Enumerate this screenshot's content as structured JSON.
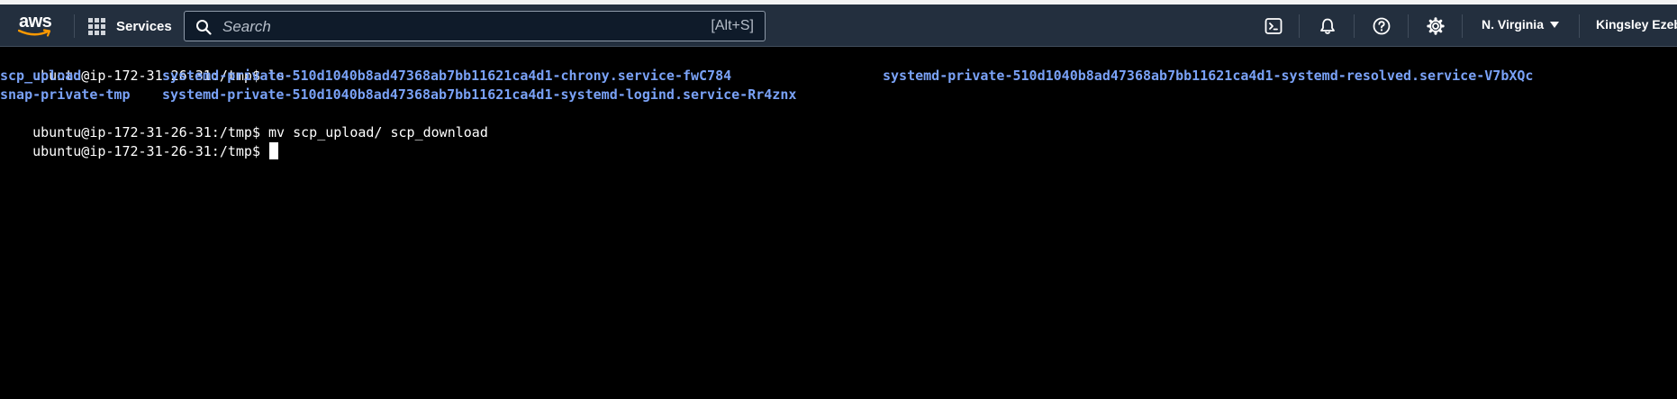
{
  "nav": {
    "logo_text": "aws",
    "services_label": "Services",
    "search_placeholder": "Search",
    "search_shortcut": "[Alt+S]",
    "icons": [
      "cloudshell-icon",
      "bell-icon",
      "help-icon",
      "settings-icon"
    ],
    "region_label": "N. Virginia",
    "user_label": "Kingsley Ezeb",
    "colors": {
      "navbar_bg": "#232f3e",
      "logo_smile": "#ff9900"
    }
  },
  "terminal": {
    "colors": {
      "background": "#000000",
      "text": "#ffffff",
      "directory": "#7aa2f7"
    },
    "commands": [
      {
        "prompt": "ubuntu@ip-172-31-26-31:/tmp$",
        "command": "ls"
      },
      {
        "prompt": "ubuntu@ip-172-31-26-31:/tmp$",
        "command": "mv scp_upload/ scp_download"
      },
      {
        "prompt": "ubuntu@ip-172-31-26-31:/tmp$",
        "command": ""
      }
    ],
    "ls_output": [
      [
        "scp_upload",
        "systemd-private-510d1040b8ad47368ab7bb11621ca4d1-chrony.service-fwC784",
        "systemd-private-510d1040b8ad47368ab7bb11621ca4d1-systemd-resolved.service-V7bXQc"
      ],
      [
        "snap-private-tmp",
        "systemd-private-510d1040b8ad47368ab7bb11621ca4d1-systemd-logind.service-Rr4znx"
      ]
    ]
  }
}
